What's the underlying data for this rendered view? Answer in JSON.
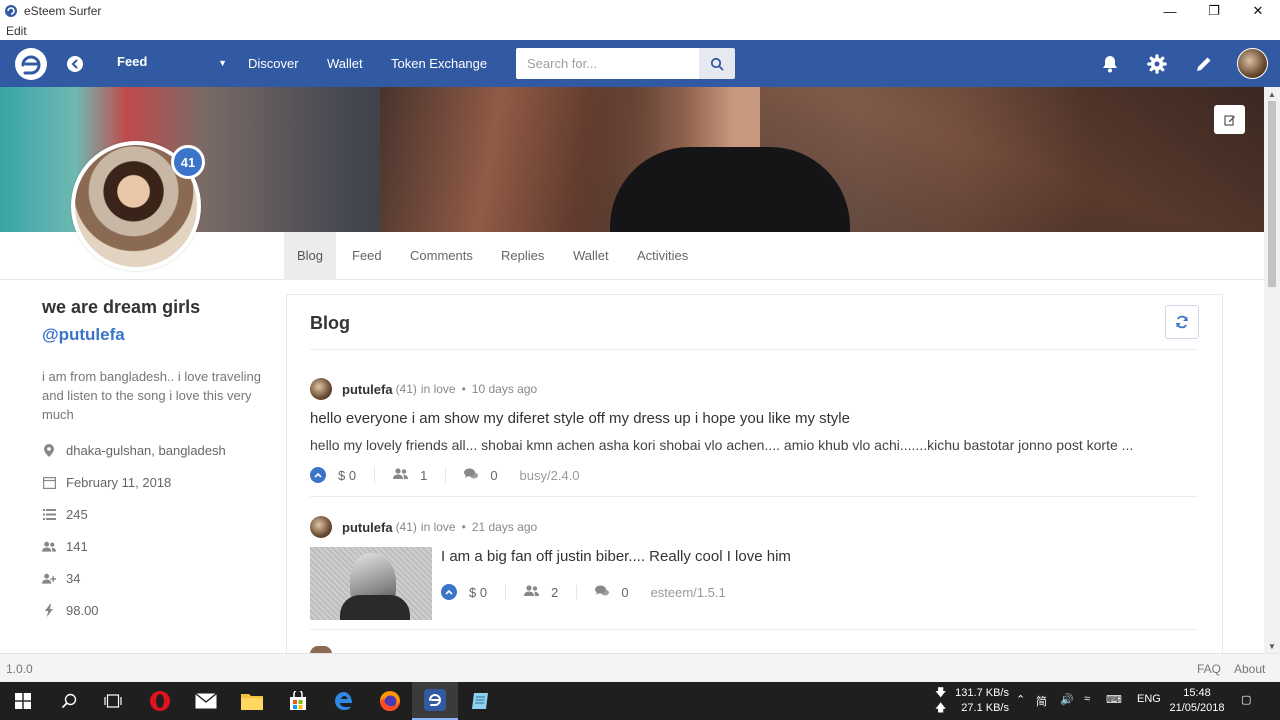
{
  "window": {
    "title": "eSteem Surfer",
    "menu_edit": "Edit"
  },
  "header": {
    "feed_label": "Feed",
    "nav": [
      "Discover",
      "Wallet",
      "Token Exchange"
    ],
    "search_placeholder": "Search for..."
  },
  "profile": {
    "reputation": "41",
    "display_name": "we are dream girls",
    "username": "@putulefa",
    "about": "i am from bangladesh.. i love traveling and listen to the song i love this very much",
    "location": "dhaka-gulshan, bangladesh",
    "joined": "February 11, 2018",
    "post_count": "245",
    "followers": "141",
    "following": "34",
    "voting_power": "98.00"
  },
  "tabs": [
    "Blog",
    "Feed",
    "Comments",
    "Replies",
    "Wallet",
    "Activities"
  ],
  "blog": {
    "title": "Blog",
    "posts": [
      {
        "author": "putulefa",
        "rep": "(41)",
        "category": "in love",
        "age": "10 days ago",
        "title": "hello everyone i am show my diferet style off my dress up i hope you like my style",
        "summary": "hello my lovely friends all... shobai kmn achen asha kori shobai vlo achen.... amio khub vlo achi.......kichu bastotar jonno post korte ...",
        "payout": "$ 0",
        "voters": "1",
        "comments": "0",
        "app": "busy/2.4.0"
      },
      {
        "author": "putulefa",
        "rep": "(41)",
        "category": "in love",
        "age": "21 days ago",
        "title": "I am a big fan off justin biber.... Really cool I love him",
        "payout": "$ 0",
        "voters": "2",
        "comments": "0",
        "app": "esteem/1.5.1"
      }
    ]
  },
  "footer": {
    "version": "1.0.0",
    "faq": "FAQ",
    "about": "About"
  },
  "taskbar": {
    "down_speed": "131.7 KB/s",
    "up_speed": "27.1 KB/s",
    "lang": "ENG",
    "time": "15:48",
    "date": "21/05/2018"
  },
  "colors": {
    "brand": "#315aa3",
    "accent": "#3b74c9"
  }
}
